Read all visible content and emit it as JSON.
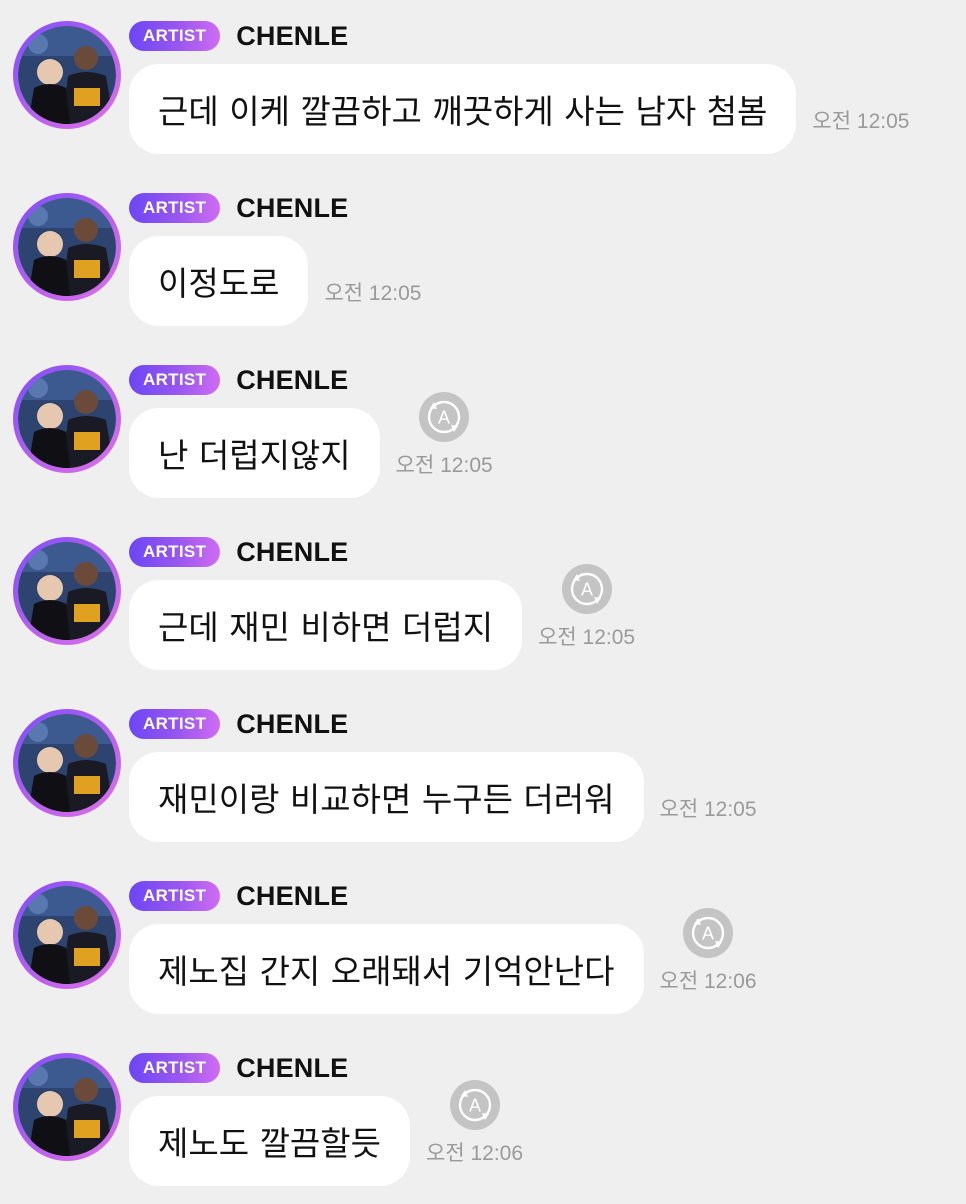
{
  "artist_badge_label": "ARTIST",
  "messages": [
    {
      "sender": "CHENLE",
      "badge": "ARTIST",
      "text": "근데 이케 깔끔하고 깨끗하게 사는 남자 첨봄",
      "time": "오전 12:05",
      "translate_icon": false
    },
    {
      "sender": "CHENLE",
      "badge": "ARTIST",
      "text": "이정도로",
      "time": "오전 12:05",
      "translate_icon": false
    },
    {
      "sender": "CHENLE",
      "badge": "ARTIST",
      "text": "난 더럽지않지",
      "time": "오전 12:05",
      "translate_icon": true
    },
    {
      "sender": "CHENLE",
      "badge": "ARTIST",
      "text": "근데 재민 비하면 더럽지",
      "time": "오전 12:05",
      "translate_icon": true
    },
    {
      "sender": "CHENLE",
      "badge": "ARTIST",
      "text": "재민이랑 비교하면 누구든 더러워",
      "time": "오전 12:05",
      "translate_icon": false
    },
    {
      "sender": "CHENLE",
      "badge": "ARTIST",
      "text": "제노집 간지 오래돼서 기억안난다",
      "time": "오전 12:06",
      "translate_icon": true
    },
    {
      "sender": "CHENLE",
      "badge": "ARTIST",
      "text": "제노도 깔끔할듯",
      "time": "오전 12:06",
      "translate_icon": true
    }
  ],
  "icons": {
    "avatar": "profile-photo",
    "translate": "translate-a-icon"
  },
  "colors": {
    "background": "#efefef",
    "bubble": "#ffffff",
    "badge_start": "#6b46f5",
    "badge_end": "#cf6cf2",
    "timestamp": "#9a9a9a",
    "translate_icon": "#c4c4c4"
  }
}
